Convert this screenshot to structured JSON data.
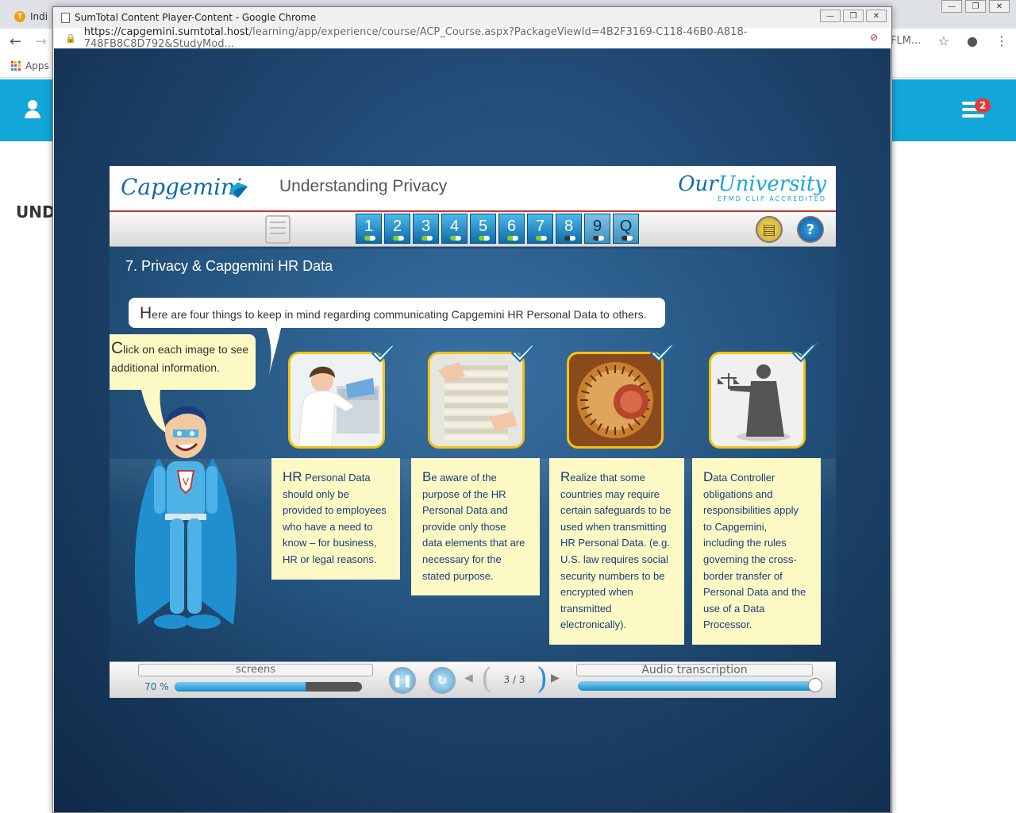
{
  "background_browser": {
    "tab_title": "Indi",
    "tab_favicon": "T",
    "apps_label": "Apps",
    "url_fragment": "FLM...",
    "page_heading": "UND",
    "notification_count": "2"
  },
  "popup": {
    "window_title": "SumTotal Content Player-Content - Google Chrome",
    "url_host": "https://capgemini.sumtotal.host",
    "url_path": "/learning/app/experience/course/ACP_Course.aspx?PackageViewId=4B2F3169-C118-46B0-A818-748FB8C8D792&StudyMod..."
  },
  "course": {
    "brand": "Capgemini",
    "title": "Understanding Privacy",
    "university_a": "Our",
    "university_b": "University",
    "university_sub": "EFMD CLIP ACCREDITED",
    "chapters": [
      {
        "label": "1",
        "state": "done"
      },
      {
        "label": "2",
        "state": "done"
      },
      {
        "label": "3",
        "state": "done"
      },
      {
        "label": "4",
        "state": "done"
      },
      {
        "label": "5",
        "state": "done"
      },
      {
        "label": "6",
        "state": "done"
      },
      {
        "label": "7",
        "state": "done"
      },
      {
        "label": "8",
        "state": "current"
      },
      {
        "label": "9",
        "state": "pending"
      },
      {
        "label": "Q",
        "state": "pending"
      }
    ],
    "section_title": "7. Privacy & Capgemini HR Data",
    "intro": "Here are four things to keep in mind regarding communicating Capgemini HR Personal Data to others.",
    "hint": "Click on each image to see additional information.",
    "cards": [
      {
        "cap": "HR",
        "text": " Personal Data should only be provided to employees who have a need to know – for business, HR or legal reasons."
      },
      {
        "cap": "B",
        "text": "e aware of the purpose of the HR Personal Data and provide only those data elements that are necessary for the stated purpose."
      },
      {
        "cap": "R",
        "text": "ealize that some countries may require certain safeguards to be used when transmitting HR Personal Data.  (e.g. U.S. law requires social security numbers to be encrypted when transmitted electronically)."
      },
      {
        "cap": "D",
        "text": "ata Controller obligations and responsibilities apply to Capgemini, including the rules governing the cross-border transfer of Personal Data and the use of a Data Processor."
      }
    ],
    "screens_label": "screens",
    "progress_text": "70 %",
    "progress": 0.7,
    "page_counter": "3 / 3",
    "audio_label": "Audio transcription"
  },
  "colors": {
    "capgemini_blue": "#0e6ba8",
    "accent_red": "#c0392b",
    "note_yellow": "#fdf9c5",
    "card_border": "#f2c30f",
    "portal_blue": "#12a7d8"
  }
}
